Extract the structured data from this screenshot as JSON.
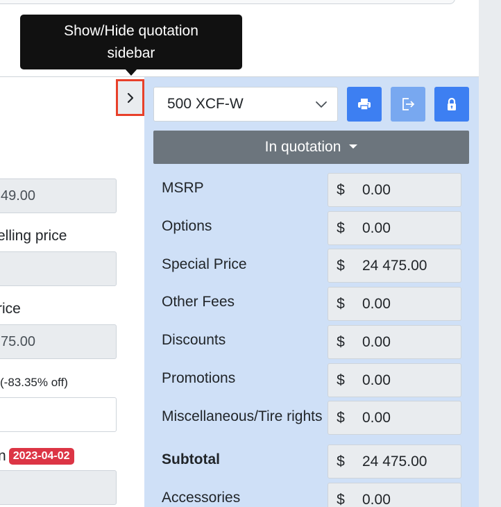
{
  "tooltip": {
    "text_line1": "Show/Hide quotation",
    "text_line2": "sidebar"
  },
  "left_panel": {
    "field1_value": "49.00",
    "label_selling_price": "elling price",
    "label_price": "rice",
    "field3_value": "75.00",
    "discount_note": "(-83.35% off)",
    "date_label": "n",
    "date_badge": "2023-04-02"
  },
  "sidebar": {
    "model_select": "500 XCF-W",
    "status_button": "In quotation",
    "currency_symbol": "$",
    "rows": [
      {
        "label": "MSRP",
        "value": "0.00"
      },
      {
        "label": "Options",
        "value": "0.00"
      },
      {
        "label": "Special Price",
        "value": "24 475.00"
      },
      {
        "label": "Other Fees",
        "value": "0.00"
      },
      {
        "label": "Discounts",
        "value": "0.00"
      },
      {
        "label": "Promotions",
        "value": "0.00"
      },
      {
        "label": "Miscellaneous/Tire rights",
        "value": "0.00"
      },
      {
        "label": "Subtotal",
        "value": "24 475.00"
      },
      {
        "label": "Accessories",
        "value": "0.00"
      }
    ]
  },
  "icons": {
    "toggle": "chevron-right-icon",
    "print": "printer-icon",
    "export": "export-icon",
    "lock": "lock-icon"
  },
  "colors": {
    "sidebar_bg": "#cfe0f7",
    "primary": "#3d7ff2",
    "highlight_border": "#e8402a",
    "badge_red": "#dc3545",
    "status_gray": "#6c757d"
  }
}
